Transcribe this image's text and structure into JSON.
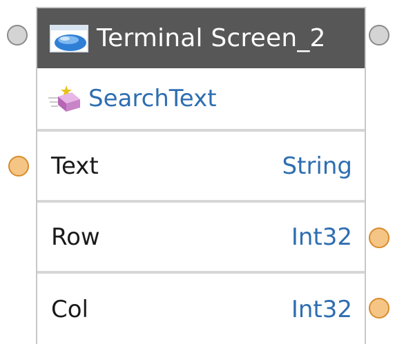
{
  "node": {
    "title": "Terminal Screen_2",
    "icon": "terminal-screen-icon",
    "method": {
      "label": "SearchText",
      "icon": "search-text-method-icon"
    },
    "params": [
      {
        "name": "Text",
        "type": "String",
        "port_side": "input"
      },
      {
        "name": "Row",
        "type": "Int32",
        "port_side": "output"
      },
      {
        "name": "Col",
        "type": "Int32",
        "port_side": "output"
      }
    ]
  },
  "colors": {
    "header_bg": "#575757",
    "type_text": "#2e6eb0",
    "port_gray": "#d4d4d4",
    "port_orange": "#f5c586"
  }
}
